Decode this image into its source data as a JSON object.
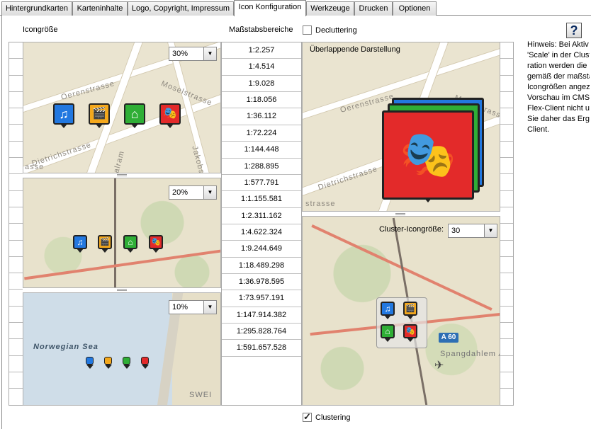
{
  "tabs": [
    {
      "label": "Hintergrundkarten"
    },
    {
      "label": "Karteninhalte"
    },
    {
      "label": "Logo, Copyright, Impressum"
    },
    {
      "label": "Icon Konfiguration",
      "active": true
    },
    {
      "label": "Werkzeuge"
    },
    {
      "label": "Drucken"
    },
    {
      "label": "Optionen"
    }
  ],
  "headers": {
    "icon_size": "Icongröße",
    "scale_ranges": "Maßstabsbereiche",
    "decluttering": "Decluttering",
    "overlapping": "Überlappende Darstellung",
    "cluster_size_label": "Cluster-Icongröße:",
    "clustering": "Clustering"
  },
  "checkboxes": {
    "decluttering": false,
    "clustering": true
  },
  "dropdowns": {
    "size_30": "30%",
    "size_20": "20%",
    "size_10": "10%",
    "cluster_size": "30"
  },
  "scales": [
    "1:2.257",
    "1:4.514",
    "1:9.028",
    "1:18.056",
    "1:36.112",
    "1:72.224",
    "1:144.448",
    "1:288.895",
    "1:577.791",
    "1:1.155.581",
    "1:2.311.162",
    "1:4.622.324",
    "1:9.244.649",
    "1:18.489.298",
    "1:36.978.595",
    "1:73.957.191",
    "1:147.914.382",
    "1:295.828.764",
    "1:591.657.528"
  ],
  "map_labels": {
    "oerenstrasse": "Oerenstrasse",
    "moselstrasse": "Moselstrasse",
    "dietrichstrasse": "Dietrichstrasse",
    "walram": "Walram",
    "jakobs": "Jakobs",
    "strasse_left": "strasse",
    "asse": "asse",
    "norwegian_sea": "Norwegian Sea",
    "swe": "SWEI",
    "a60": "A 60",
    "spangdahlem": "Spangdahlem A"
  },
  "hint_lines": [
    "Hinweis: Bei Aktiv",
    "'Scale' in der Clust",
    "ration werden die I",
    "gemäß der maßsta",
    "Icongrößen angez",
    "Vorschau im CMS",
    "Flex-Client nicht u",
    "Sie daher das Erge",
    "Client."
  ],
  "help_label": "?",
  "icon_glyphs": {
    "music": "♫",
    "cinema": "🎬",
    "museum": "⌂",
    "theater": "🎭"
  },
  "colors": {
    "blue": "#2278e0",
    "orange": "#f4a81c",
    "green": "#2fae36",
    "red": "#e32a2a"
  }
}
